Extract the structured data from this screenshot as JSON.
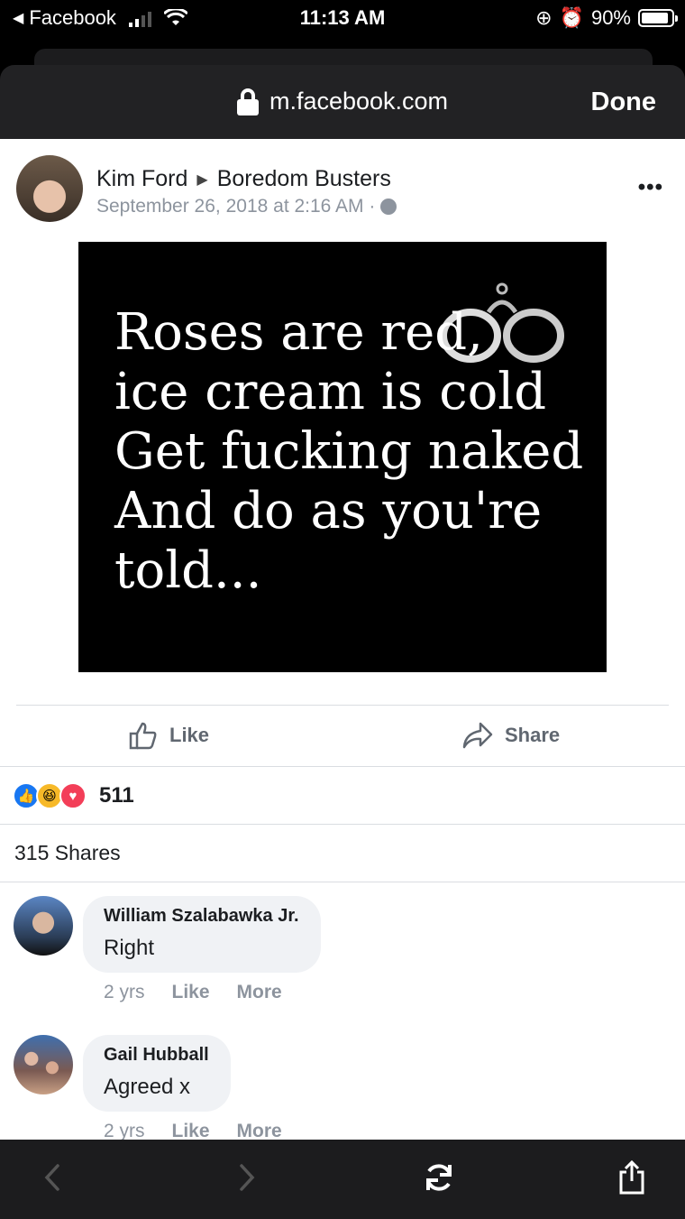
{
  "status_bar": {
    "back_app": "Facebook",
    "time": "11:13 AM",
    "battery": "90%",
    "battery_level": 0.9
  },
  "browser": {
    "url": "m.facebook.com",
    "done_label": "Done"
  },
  "post": {
    "author": "Kim Ford",
    "group": "Boredom Busters",
    "timestamp": "September 26, 2018 at 2:16 AM ·",
    "image_text": [
      "Roses are red,",
      "ice cream is cold",
      "Get fucking naked",
      "And do as you're",
      "told..."
    ]
  },
  "actions": {
    "like": "Like",
    "share": "Share"
  },
  "reactions": {
    "count": "511",
    "types": [
      "like",
      "haha",
      "love"
    ]
  },
  "shares": "315 Shares",
  "comments": [
    {
      "author": "William Szalabawka Jr.",
      "text": "Right",
      "age": "2 yrs",
      "like": "Like",
      "more": "More"
    },
    {
      "author": "Gail Hubball",
      "text": "Agreed x",
      "age": "2 yrs",
      "like": "Like",
      "more": "More"
    }
  ],
  "colors": {
    "facebook_blue": "#1877f2",
    "love_red": "#f33e58",
    "haha_yellow": "#f7b928"
  }
}
